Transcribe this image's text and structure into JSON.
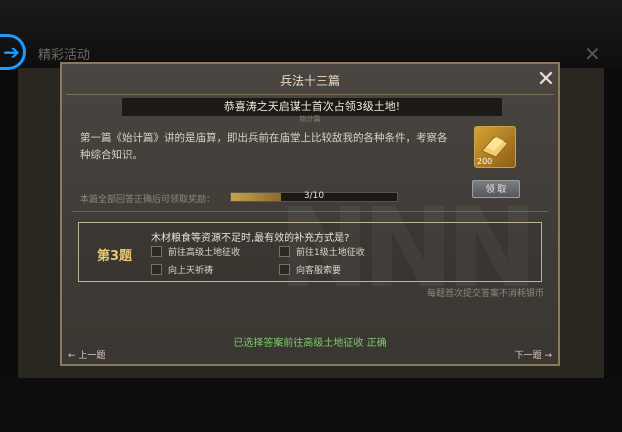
{
  "background": {
    "title": "精彩活动"
  },
  "dialog": {
    "title": "兵法十三篇",
    "notice": "恭喜涛之天启谋士首次占领3级土地!",
    "subtitle": "始计篇",
    "description": "第一篇《始计篇》讲的是庙算，即出兵前在庙堂上比较敌我的各种条件，考察各种综合知识。",
    "reward": {
      "quantity": "200",
      "icon": "gold-ingot-icon",
      "claim_label": "领 取"
    },
    "progress": {
      "label": "本篇全部回答正确后可领取奖励：",
      "text": "3/10",
      "fraction": 0.3
    },
    "question": {
      "number_label": "第3题",
      "text": "木材粮食等资源不足时,最有效的补充方式是?",
      "options": [
        "前往高级土地征收",
        "前往1级土地征收",
        "向上天祈祷",
        "向客服索要"
      ]
    },
    "free_note": "每题首次提交答案不消耗银币",
    "result": "已选择答案前往高级土地征收 正确",
    "prev_label": "上一题",
    "next_label": "下一题"
  },
  "colors": {
    "accent_blue": "#1e9bff",
    "correct_green": "#7ecb6a",
    "question_gold": "#e9c775"
  }
}
